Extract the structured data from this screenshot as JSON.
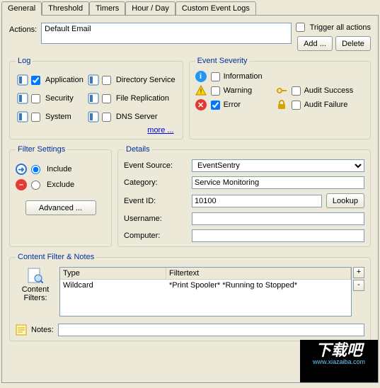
{
  "tabs": {
    "general": "General",
    "threshold": "Threshold",
    "timers": "Timers",
    "hourday": "Hour / Day",
    "custom": "Custom Event Logs"
  },
  "actions": {
    "label": "Actions:",
    "value": "Default Email",
    "trigger_all": "Trigger all actions",
    "add": "Add ...",
    "delete": "Delete"
  },
  "log": {
    "legend": "Log",
    "application": "Application",
    "security": "Security",
    "system": "System",
    "directory": "Directory Service",
    "filerep": "File Replication",
    "dns": "DNS Server",
    "more": "more ..."
  },
  "severity": {
    "legend": "Event Severity",
    "information": "Information",
    "warning": "Warning",
    "error": "Error",
    "audit_success": "Audit Success",
    "audit_failure": "Audit Failure"
  },
  "filter": {
    "legend": "Filter Settings",
    "include": "Include",
    "exclude": "Exclude",
    "advanced": "Advanced ..."
  },
  "details": {
    "legend": "Details",
    "event_source_label": "Event Source:",
    "event_source_value": "EventSentry",
    "category_label": "Category:",
    "category_value": "Service Monitoring",
    "eventid_label": "Event ID:",
    "eventid_value": "10100",
    "lookup": "Lookup",
    "username_label": "Username:",
    "username_value": "",
    "computer_label": "Computer:",
    "computer_value": ""
  },
  "content_filter": {
    "legend": "Content Filter & Notes",
    "content_filters_label": "Content\nFilters:",
    "col_type": "Type",
    "col_filtertext": "Filtertext",
    "row_type": "Wildcard",
    "row_filtertext": "*Print Spooler* *Running to Stopped*",
    "plus": "+",
    "minus": "-",
    "notes_label": "Notes:",
    "notes_value": ""
  },
  "watermark": {
    "big": "下载吧",
    "small": "www.xiazaiba.com"
  }
}
